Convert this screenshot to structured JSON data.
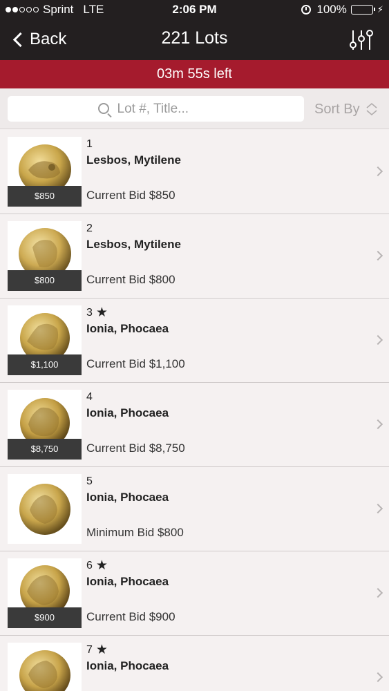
{
  "status_bar": {
    "carrier": "Sprint",
    "network": "LTE",
    "time": "2:06 PM",
    "battery": "100%",
    "signal_bars_filled": 2,
    "signal_bars_total": 5
  },
  "nav": {
    "back_label": "Back",
    "title": "221 Lots"
  },
  "timer": {
    "text": "03m 55s left"
  },
  "search": {
    "placeholder": "Lot #, Title...",
    "sort_label": "Sort By"
  },
  "lots": [
    {
      "number": "1",
      "starred": false,
      "title": "Lesbos, Mytilene",
      "bid": "Current Bid $850",
      "badge": "$850"
    },
    {
      "number": "2",
      "starred": false,
      "title": "Lesbos, Mytilene",
      "bid": "Current Bid $800",
      "badge": "$800"
    },
    {
      "number": "3",
      "starred": true,
      "title": "Ionia, Phocaea",
      "bid": "Current Bid $1,100",
      "badge": "$1,100"
    },
    {
      "number": "4",
      "starred": false,
      "title": "Ionia, Phocaea",
      "bid": "Current Bid $8,750",
      "badge": "$8,750"
    },
    {
      "number": "5",
      "starred": false,
      "title": "Ionia, Phocaea",
      "bid": "Minimum Bid $800",
      "badge": ""
    },
    {
      "number": "6",
      "starred": true,
      "title": "Ionia, Phocaea",
      "bid": "Current Bid $900",
      "badge": "$900"
    },
    {
      "number": "7",
      "starred": true,
      "title": "Ionia, Phocaea",
      "bid": "",
      "badge": ""
    }
  ],
  "colors": {
    "nav_bg": "#231f20",
    "timer_bg": "#a51b2d",
    "battery": "#4cd964",
    "list_bg": "#f5f1f1",
    "badge_bg": "#3a3a3a",
    "coin_gold": "#c9a64a"
  }
}
